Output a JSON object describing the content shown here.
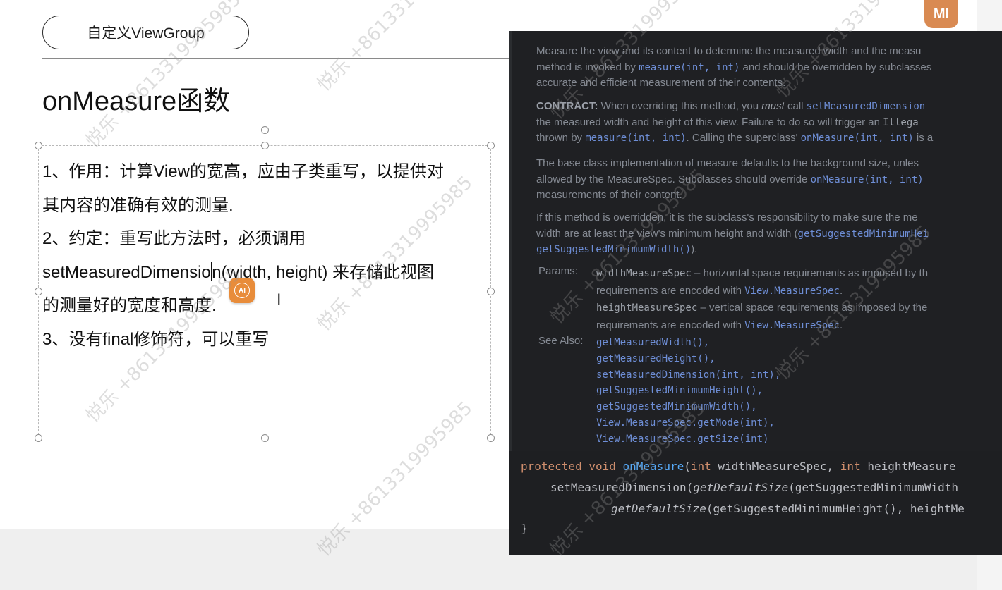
{
  "slide": {
    "header_pill": "自定义ViewGroup",
    "title": "onMeasure函数",
    "lines": [
      "1、作用：计算View的宽高，应由子类重写，以提供对",
      "其内容的准确有效的测量.",
      "2、约定：重写此方法时，必须调用",
      "setMeasuredDimensio",
      "n(width, height) 来存储此视图",
      "的测量好的宽度和高度.",
      "3、没有final修饰符，可以重写"
    ],
    "ai_badge": "AI"
  },
  "brand_logo": "MI",
  "doc": {
    "p1": [
      "Measure the view and its content to determine the measured width and the measu",
      "method is invoked by ",
      "measure(int, int)",
      " and should be overridden by subclasses",
      "accurate and efficient measurement of their contents."
    ],
    "p2": [
      "CONTRACT:",
      " When overriding this method, you ",
      "must",
      " call ",
      "setMeasuredDimension",
      "the measured width and height of this view. Failure to do so will trigger an ",
      "Illega",
      "thrown by ",
      "measure(int, int)",
      ". Calling the superclass' ",
      "onMeasure(int, int)",
      " is a"
    ],
    "p3": [
      "The base class implementation of measure defaults to the background size, unles",
      "allowed by the MeasureSpec. Subclasses should override ",
      "onMeasure(int, int)",
      "measurements of their content."
    ],
    "p4": [
      "If this method is overridden, it is the subclass's responsibility to make sure the me",
      "width are at least the view's minimum height and width (",
      "getSuggestedMinimumHei",
      "getSuggestedMinimumWidth()",
      ")."
    ],
    "params_label": "Params:",
    "params": [
      "widthMeasureSpec",
      " – horizontal space requirements as imposed by th",
      "requirements are encoded with ",
      "View.MeasureSpec",
      ".",
      "heightMeasureSpec",
      " – vertical space requirements as imposed by the",
      "requirements are encoded with ",
      "View.MeasureSpec",
      "."
    ],
    "see_also_label": "See Also:",
    "see_also": [
      "getMeasuredWidth(),",
      "getMeasuredHeight(),",
      "setMeasuredDimension(int, int),",
      "getSuggestedMinimumHeight(),",
      "getSuggestedMinimumWidth(),",
      "View.MeasureSpec.getMode(int),",
      "View.MeasureSpec.getSize(int)"
    ]
  },
  "code": {
    "l1": [
      "protected",
      " ",
      "void",
      " ",
      "onMeasure",
      "(",
      "int",
      " widthMeasureSpec, ",
      "int",
      " heightMeasure"
    ],
    "l2": [
      "setMeasuredDimension(",
      "getDefaultSize",
      "(getSuggestedMinimumWidth"
    ],
    "l3": [
      "getDefaultSize",
      "(getSuggestedMinimumHeight(), heightMe"
    ],
    "l4": "}"
  },
  "watermark": "悦乐 +8613319995985"
}
